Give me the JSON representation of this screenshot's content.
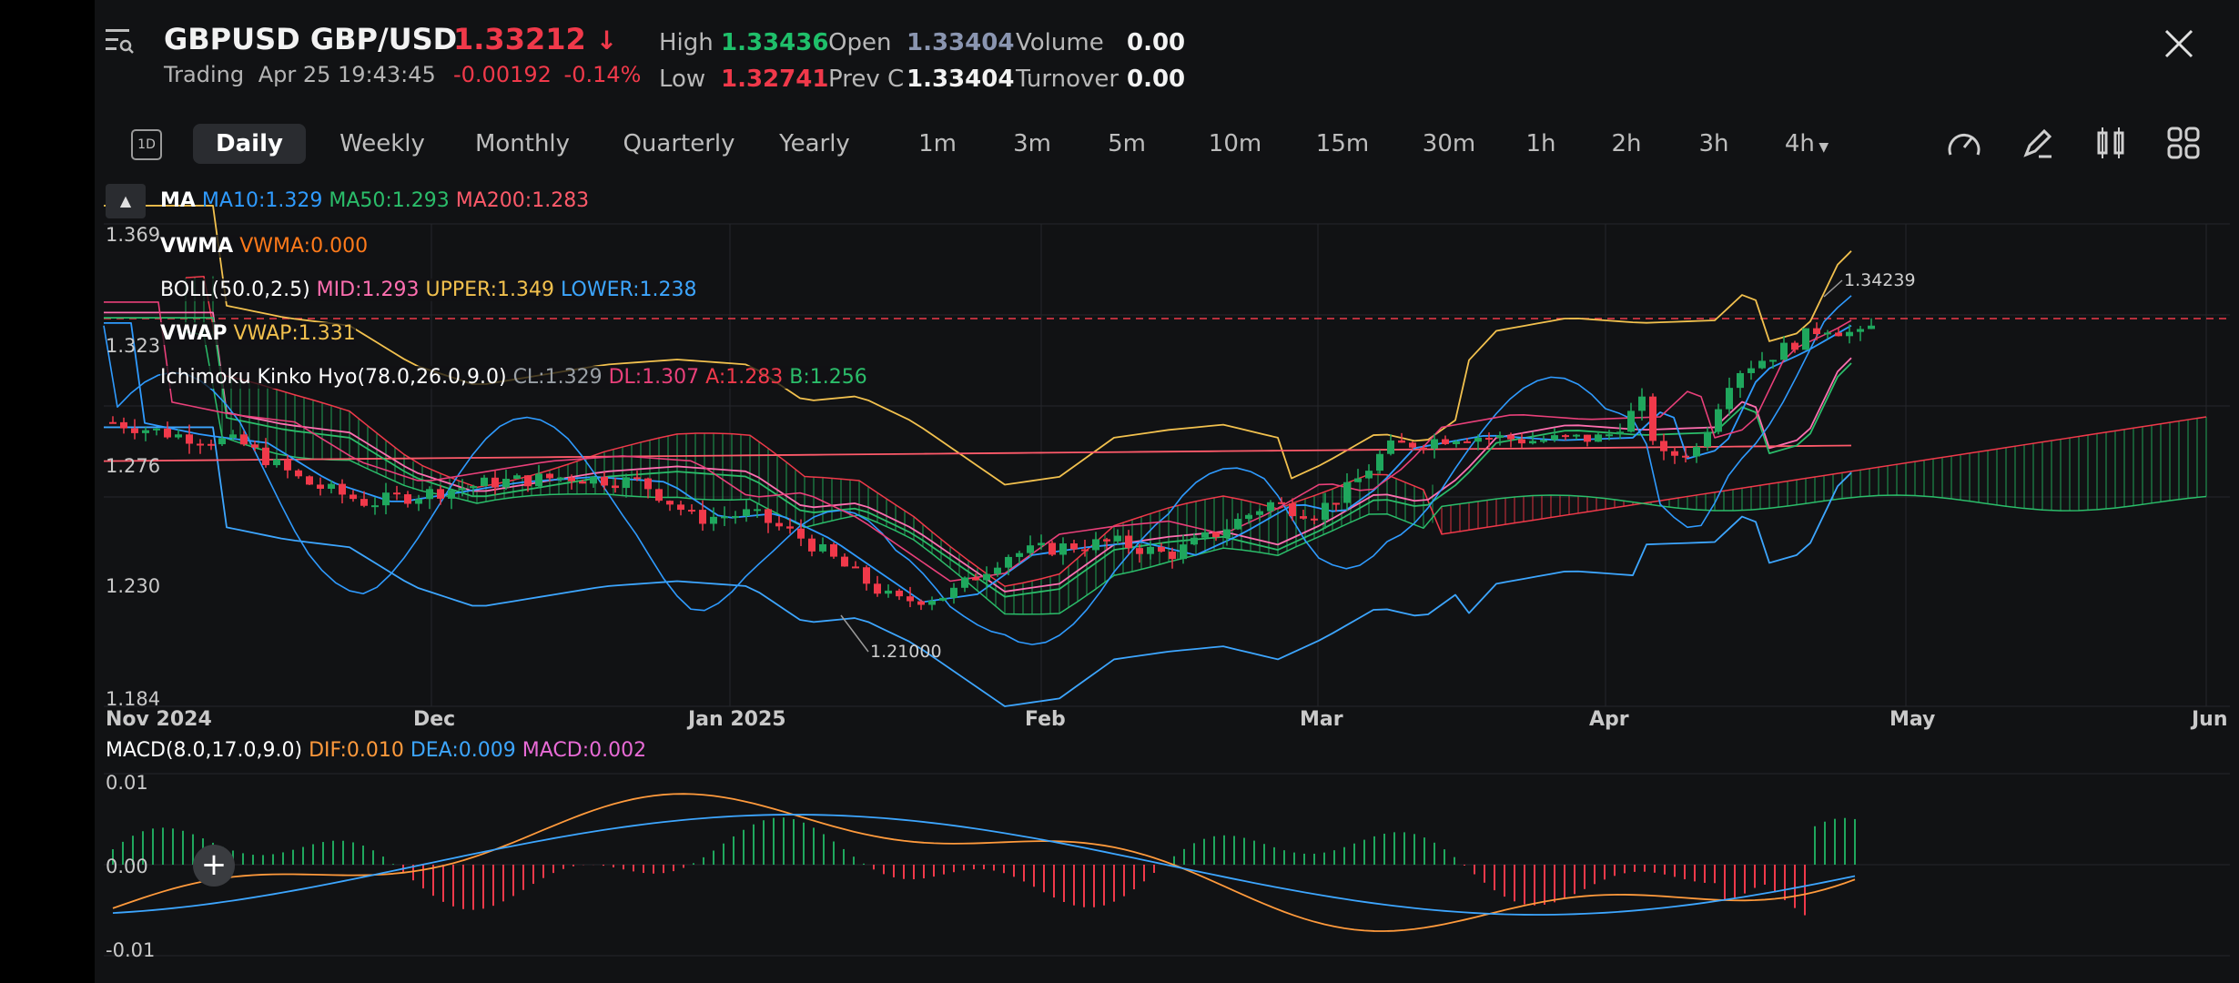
{
  "header": {
    "symbol": "GBPUSD",
    "pair": "GBP/USD",
    "price": "1.33212",
    "status": "Trading",
    "timestamp": "Apr 25 19:43:45",
    "change": "-0.00192",
    "change_pct": "-0.14%",
    "stats": {
      "high_label": "High",
      "high": "1.33436",
      "low_label": "Low",
      "low": "1.32741",
      "open_label": "Open",
      "open": "1.33404",
      "prevc_label": "Prev C",
      "prevc": "1.33404",
      "volume_label": "Volume",
      "volume": "0.00",
      "turnover_label": "Turnover",
      "turnover": "0.00"
    }
  },
  "timeframes": [
    "Daily",
    "Weekly",
    "Monthly",
    "Quarterly",
    "Yearly",
    "1m",
    "3m",
    "5m",
    "10m",
    "15m",
    "30m",
    "1h",
    "2h",
    "3h",
    "4h"
  ],
  "timeframe_badge": "1D",
  "indicators": {
    "ma_label": "MA",
    "ma10": "MA10:1.329",
    "ma50": "MA50:1.293",
    "ma200": "MA200:1.283",
    "vwma_label": "VWMA",
    "vwma": "VWMA:0.000",
    "boll_label": "BOLL(50.0,2.5)",
    "boll_mid": "MID:1.293",
    "boll_upper": "UPPER:1.349",
    "boll_lower": "LOWER:1.238",
    "vwap_label": "VWAP",
    "vwap": "VWAP:1.331",
    "ichi_label": "Ichimoku Kinko Hyo(78.0,26.0,9.0)",
    "ichi_cl": "CL:1.329",
    "ichi_dl": "DL:1.307",
    "ichi_a": "A:1.283",
    "ichi_b": "B:1.256"
  },
  "price_axis": [
    "1.369",
    "1.323",
    "1.276",
    "1.230",
    "1.184"
  ],
  "date_axis": [
    "Nov 2024",
    "Dec",
    "Jan 2025",
    "Feb",
    "Mar",
    "Apr",
    "May",
    "Jun"
  ],
  "annotations": {
    "high": "1.34239",
    "low": "1.21000"
  },
  "macd": {
    "label": "MACD(8.0,17.0,9.0)",
    "dif": "DIF:0.010",
    "dea": "DEA:0.009",
    "macd": "MACD:0.002",
    "axis": [
      "0.01",
      "0.00",
      "-0.01"
    ]
  },
  "colors": {
    "up": "#1fa75d",
    "down": "#f0394a",
    "ma10": "#2f9bff",
    "ma50": "#2bbd6a",
    "ma200": "#ff5a6a",
    "vwma": "#ff7a1a",
    "boll_mid": "#ff6fb0",
    "boll_upper": "#f2c14e",
    "boll_lower": "#3da6ff",
    "vwap": "#f2c14e",
    "ichi_cl": "#9aa0a6",
    "ichi_dl": "#e9407a",
    "ichi_a": "#f0394a",
    "ichi_b": "#2bbd6a",
    "dif": "#ff9a3c",
    "dea": "#3da6ff",
    "macd": "#e86bd6"
  },
  "icons": [
    "menu-search-icon",
    "close-icon",
    "speedometer-icon",
    "pencil-icon",
    "candle-type-icon",
    "grid-icon",
    "collapse-arrow-icon",
    "plus-icon"
  ],
  "chart_data": {
    "type": "line",
    "title": "",
    "x": [
      "Nov 2024",
      "Dec",
      "Jan 2025",
      "Feb",
      "Mar",
      "Apr",
      "May",
      "Jun"
    ],
    "ylim": [
      1.184,
      1.369
    ],
    "series": [
      {
        "name": "MA10",
        "values": [
          1.27,
          1.28,
          1.26,
          1.25,
          1.265,
          1.29,
          1.3,
          1.329
        ]
      },
      {
        "name": "MA50",
        "values": [
          1.29,
          1.28,
          1.27,
          1.255,
          1.255,
          1.265,
          1.28,
          1.293
        ]
      },
      {
        "name": "MA200",
        "values": [
          1.275,
          1.276,
          1.277,
          1.278,
          1.279,
          1.28,
          1.282,
          1.283
        ]
      }
    ]
  }
}
